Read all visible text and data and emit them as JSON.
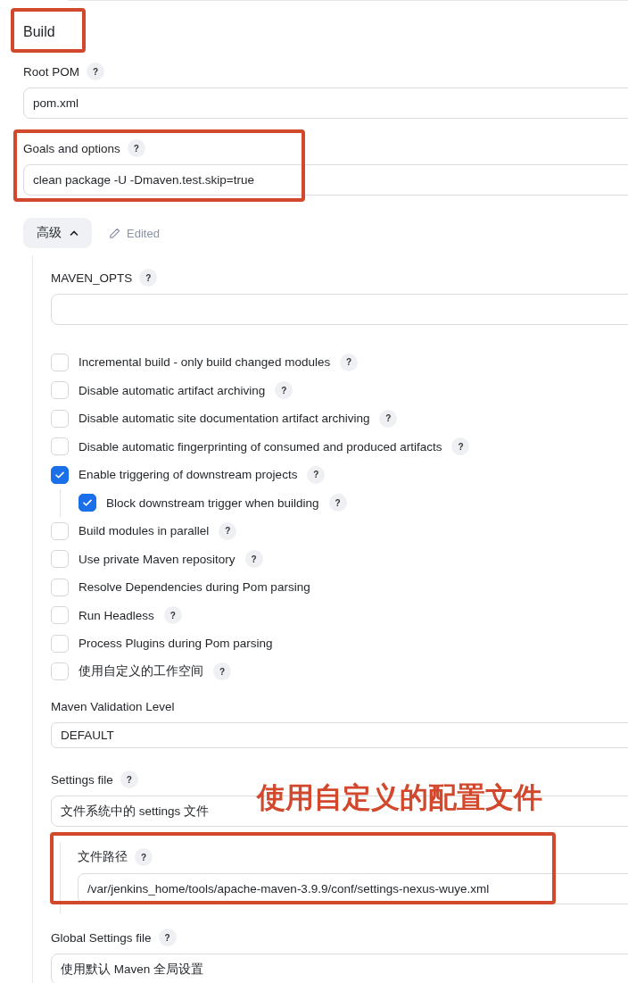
{
  "heading": {
    "text": "Build",
    "highlighted": true
  },
  "root_pom": {
    "label": "Root POM",
    "help": "?",
    "value": "pom.xml"
  },
  "goals": {
    "label": "Goals and options",
    "help": "?",
    "value": "clean package -U -Dmaven.test.skip=true",
    "highlighted": true
  },
  "advanced": {
    "label": "高级",
    "expanded": true,
    "edited": "Edited"
  },
  "maven_opts": {
    "label": "MAVEN_OPTS",
    "help": "?"
  },
  "options": [
    {
      "label": "Incremental build - only build changed modules",
      "help": "?",
      "checked": false
    },
    {
      "label": "Disable automatic artifact archiving",
      "help": "?",
      "checked": false
    },
    {
      "label": "Disable automatic site documentation artifact archiving",
      "help": "?",
      "checked": false
    },
    {
      "label": "Disable automatic fingerprinting of consumed and produced artifacts",
      "help": "?",
      "checked": false
    },
    {
      "label": "Enable triggering of downstream projects",
      "help": "?",
      "checked": true,
      "children": [
        {
          "label": "Block downstream trigger when building",
          "help": "?",
          "checked": true
        }
      ]
    },
    {
      "label": "Build modules in parallel",
      "help": "?",
      "checked": false
    },
    {
      "label": "Use private Maven repository",
      "help": "?",
      "checked": false
    },
    {
      "label": "Resolve Dependencies during Pom parsing",
      "checked": false
    },
    {
      "label": "Run Headless",
      "help": "?",
      "checked": false
    },
    {
      "label": "Process Plugins during Pom parsing",
      "checked": false
    },
    {
      "label": "使用自定义的工作空间",
      "help": "?",
      "checked": false
    }
  ],
  "validation": {
    "label": "Maven Validation Level",
    "value": "DEFAULT"
  },
  "settings_file": {
    "label": "Settings file",
    "help": "?",
    "value": "文件系统中的 settings 文件",
    "annotation": "使用自定义的配置文件",
    "file_path": {
      "label": "文件路径",
      "help": "?",
      "value": "/var/jenkins_home/tools/apache-maven-3.9.9/conf/settings-nexus-wuye.xml",
      "highlighted": true
    }
  },
  "global_settings": {
    "label": "Global Settings file",
    "help": "?",
    "value": "使用默认 Maven 全局设置"
  }
}
